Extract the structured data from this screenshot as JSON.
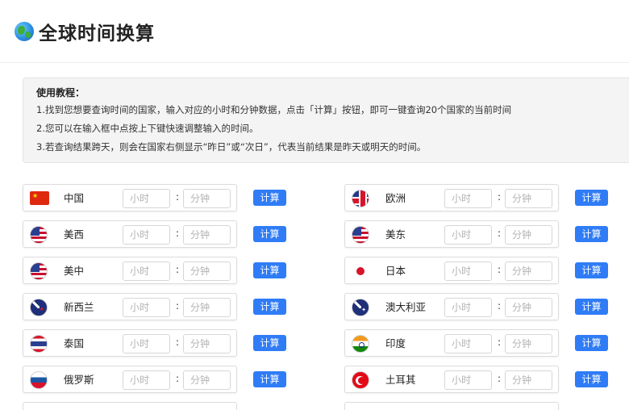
{
  "header": {
    "title": "全球时间换算",
    "icon": "globe-icon"
  },
  "tutorial": {
    "title": "使用教程：",
    "lines": [
      "1.找到您想要查询时间的国家，输入对应的小时和分钟数据，点击「计算」按钮，即可一键查询20个国家的当前时间",
      "2.您可以在输入框中点按上下键快速调整输入的时间。",
      "3.若查询结果跨天，则会在国家右侧显示“昨日”或“次日”，代表当前结果是昨天或明天的时间。"
    ]
  },
  "inputs": {
    "hour_placeholder": "小时",
    "minute_placeholder": "分钟",
    "separator": ":"
  },
  "calc_label": "计算",
  "left_column": [
    {
      "name": "中国",
      "flag": "china-flag-icon"
    },
    {
      "name": "美西",
      "flag": "usa-flag-icon"
    },
    {
      "name": "美中",
      "flag": "usa-flag-icon"
    },
    {
      "name": "新西兰",
      "flag": "new-zealand-flag-icon"
    },
    {
      "name": "泰国",
      "flag": "thailand-flag-icon"
    },
    {
      "name": "俄罗斯",
      "flag": "russia-flag-icon"
    }
  ],
  "right_column": [
    {
      "name": "欧洲",
      "flag": "uk-flag-icon"
    },
    {
      "name": "美东",
      "flag": "usa-flag-icon"
    },
    {
      "name": "日本",
      "flag": "japan-flag-icon"
    },
    {
      "name": "澳大利亚",
      "flag": "australia-flag-icon"
    },
    {
      "name": "印度",
      "flag": "india-flag-icon"
    },
    {
      "name": "土耳其",
      "flag": "turkey-flag-icon"
    }
  ]
}
